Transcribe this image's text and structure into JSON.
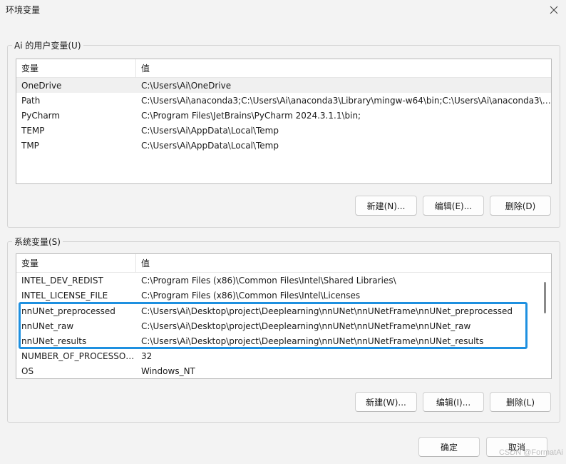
{
  "window": {
    "title": "环境变量",
    "close_icon": "close-icon"
  },
  "user_vars": {
    "group_label": "Ai 的用户变量(U)",
    "columns": [
      "变量",
      "值"
    ],
    "rows": [
      {
        "name": "OneDrive",
        "value": "C:\\Users\\Ai\\OneDrive"
      },
      {
        "name": "Path",
        "value": "C:\\Users\\Ai\\anaconda3;C:\\Users\\Ai\\anaconda3\\Library\\mingw-w64\\bin;C:\\Users\\Ai\\anaconda3\\L..."
      },
      {
        "name": "PyCharm",
        "value": "C:\\Program Files\\JetBrains\\PyCharm 2024.3.1.1\\bin;"
      },
      {
        "name": "TEMP",
        "value": "C:\\Users\\Ai\\AppData\\Local\\Temp"
      },
      {
        "name": "TMP",
        "value": "C:\\Users\\Ai\\AppData\\Local\\Temp"
      }
    ],
    "buttons": {
      "new": "新建(N)...",
      "edit": "编辑(E)...",
      "delete": "删除(D)"
    }
  },
  "system_vars": {
    "group_label": "系统变量(S)",
    "columns": [
      "变量",
      "值"
    ],
    "rows": [
      {
        "name": "INTEL_DEV_REDIST",
        "value": "C:\\Program Files (x86)\\Common Files\\Intel\\Shared Libraries\\"
      },
      {
        "name": "INTEL_LICENSE_FILE",
        "value": "C:\\Program Files (x86)\\Common Files\\Intel\\Licenses"
      },
      {
        "name": "nnUNet_preprocessed",
        "value": "C:\\Users\\Ai\\Desktop\\project\\Deeplearning\\nnUNet\\nnUNetFrame\\nnUNet_preprocessed"
      },
      {
        "name": "nnUNet_raw",
        "value": "C:\\Users\\Ai\\Desktop\\project\\Deeplearning\\nnUNet\\nnUNetFrame\\nnUNet_raw"
      },
      {
        "name": "nnUNet_results",
        "value": "C:\\Users\\Ai\\Desktop\\project\\Deeplearning\\nnUNet\\nnUNetFrame\\nnUNet_results"
      },
      {
        "name": "NUMBER_OF_PROCESSORS",
        "value": "32"
      },
      {
        "name": "OS",
        "value": "Windows_NT"
      }
    ],
    "buttons": {
      "new": "新建(W)...",
      "edit": "编辑(I)...",
      "delete": "删除(L)"
    }
  },
  "footer": {
    "ok": "确定",
    "cancel": "取消"
  },
  "watermark": "CSDN @FormatAi",
  "colors": {
    "highlight_border": "#1e90e0",
    "background": "#f3f3f3"
  }
}
